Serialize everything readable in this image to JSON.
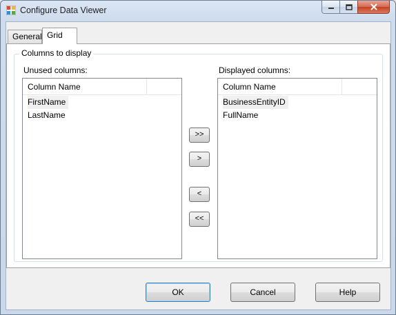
{
  "window": {
    "title": "Configure Data Viewer",
    "icon": "data-viewer-app-icon"
  },
  "tabs": [
    {
      "label": "General",
      "selected": false
    },
    {
      "label": "Grid",
      "selected": true
    }
  ],
  "group": {
    "legend": "Columns to display",
    "unused": {
      "label": "Unused columns:",
      "header": "Column Name",
      "rows": [
        "FirstName",
        "LastName"
      ]
    },
    "displayed": {
      "label": "Displayed columns:",
      "header": "Column Name",
      "rows": [
        "BusinessEntityID",
        "FullName"
      ]
    },
    "move_buttons": {
      "add_all": ">>",
      "add": ">",
      "remove": "<",
      "remove_all": "<<"
    }
  },
  "buttons": {
    "ok": "OK",
    "cancel": "Cancel",
    "help": "Help"
  }
}
